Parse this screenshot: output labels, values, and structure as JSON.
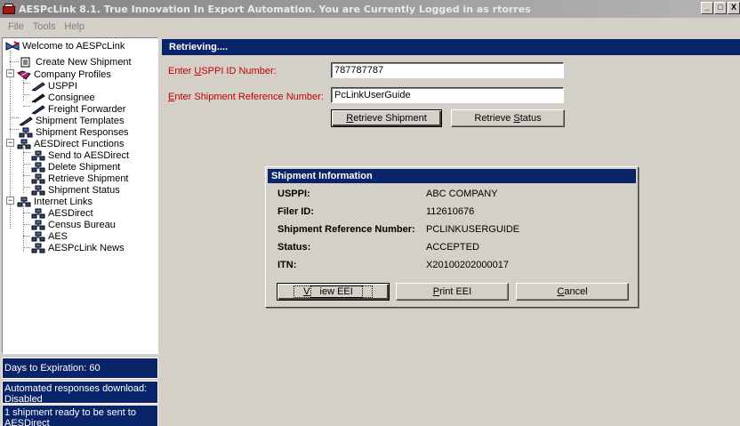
{
  "window": {
    "title": "AESPcLink 8.1. True Innovation In Export Automation. You are Currently Logged in as rtorres",
    "minimize": "_",
    "maximize": "□",
    "close": "X"
  },
  "menu": {
    "items": [
      "File",
      "Tools",
      "Help"
    ]
  },
  "tree": {
    "items": [
      "Welcome to AESPcLink",
      "Create New Shipment",
      "Company Profiles",
      "USPPI",
      "Consignee",
      "Freight Forwarder",
      "Shipment Templates",
      "Shipment Responses",
      "AESDirect Functions",
      "Send to AESDirect",
      "Delete Shipment",
      "Retrieve Shipment",
      "Shipment Status",
      "Internet Links",
      "AESDirect",
      "Census Bureau",
      "AES",
      "AESPcLink News"
    ],
    "expanders": {
      "collapse": "−"
    }
  },
  "status": {
    "expiration": "Days to Expiration: 60",
    "responses": "Automated  responses download: Disabled",
    "ready": "1 shipment ready to be sent to AESDirect"
  },
  "main": {
    "header": "Retrieving....",
    "usppi_label_pre": "Enter ",
    "usppi_label_u": "U",
    "usppi_label_post": "SPPI ID Number:",
    "usppi_value": "787787787",
    "ref_label_pre": "",
    "ref_label_u": "E",
    "ref_label_post": "nter Shipment Reference Number:",
    "ref_value": "PcLinkUserGuide",
    "retrieve_shipment_u": "R",
    "retrieve_shipment_rest": "etrieve Shipment",
    "retrieve_status_pre": "Retrieve ",
    "retrieve_status_u": "S",
    "retrieve_status_post": "tatus"
  },
  "dialog": {
    "title": "Shipment Information",
    "rows": [
      {
        "label": "USPPI:",
        "value": "ABC COMPANY"
      },
      {
        "label": "Filer ID:",
        "value": "112610676"
      },
      {
        "label": "Shipment Reference Number:",
        "value": "PCLINKUSERGUIDE"
      },
      {
        "label": "Status:",
        "value": "ACCEPTED"
      },
      {
        "label": "ITN:",
        "value": "X20100202000017"
      }
    ],
    "view_u": "V",
    "view_rest": "iew EEI",
    "print_u": "P",
    "print_rest": "rint EEI",
    "cancel_u": "C",
    "cancel_rest": "ancel"
  }
}
